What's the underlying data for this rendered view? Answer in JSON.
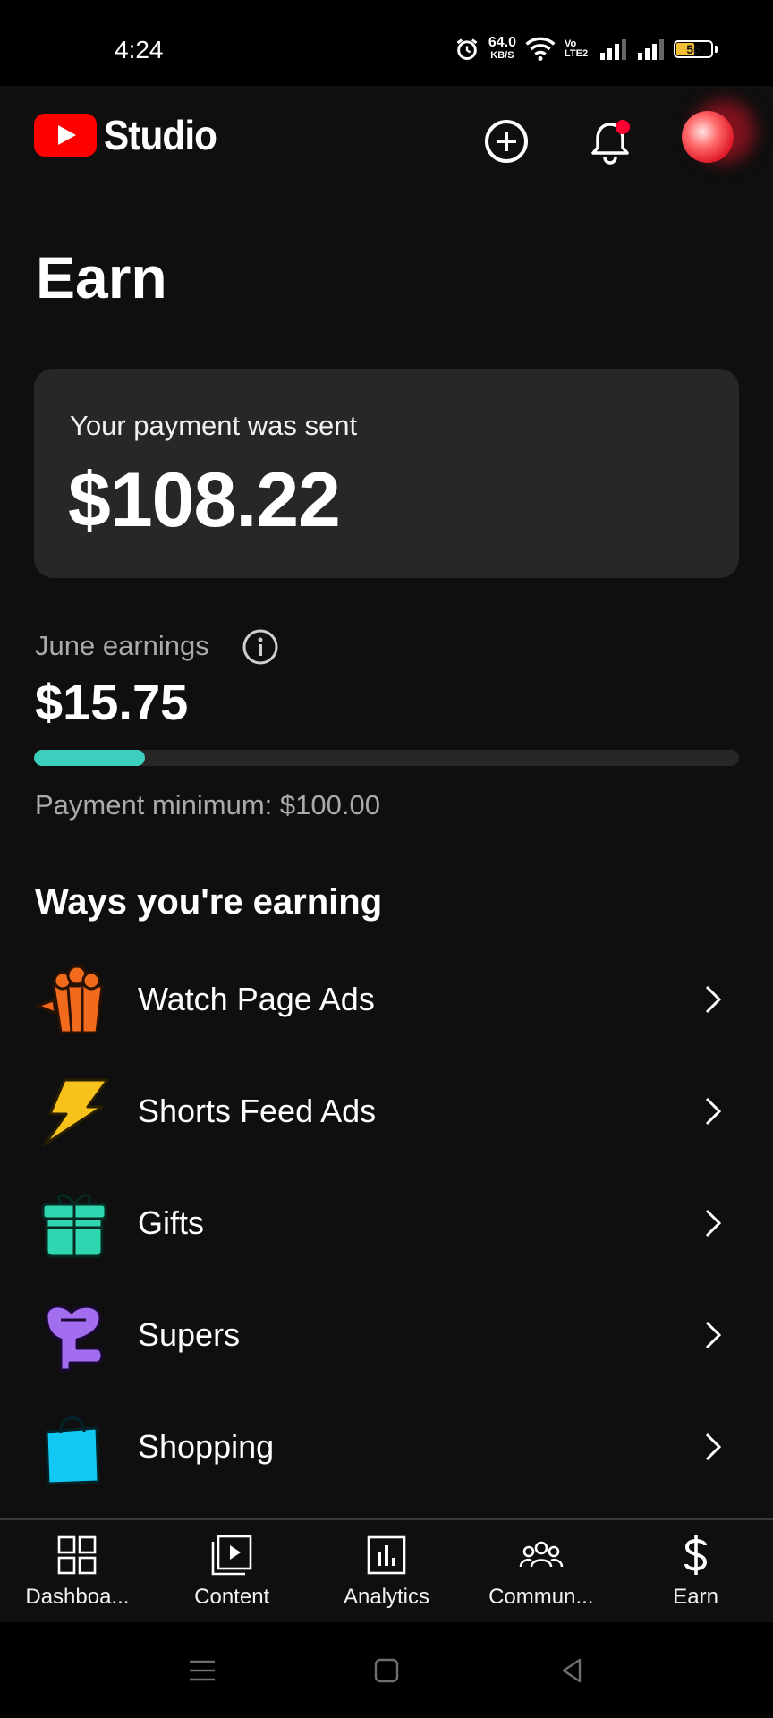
{
  "status_bar": {
    "time": "4:24",
    "net_speed": "64.0",
    "net_unit": "KB/S",
    "volte": "Vo LTE2",
    "battery": "55",
    "battery_level": 0.55
  },
  "app_bar": {
    "brand": "Studio",
    "icons": [
      "youtube-logo-icon",
      "create-icon",
      "bell-icon",
      "avatar"
    ]
  },
  "page": {
    "title": "Earn"
  },
  "payment": {
    "label": "Your payment was sent",
    "amount": "$108.22"
  },
  "earnings": {
    "label": "June earnings",
    "amount": "$15.75",
    "progress_fraction": 0.1575,
    "minimum_label": "Payment minimum: $100.00"
  },
  "ways": {
    "title": "Ways you're earning",
    "items": [
      {
        "label": "Watch Page Ads",
        "icon": "popcorn-icon"
      },
      {
        "label": "Shorts Feed Ads",
        "icon": "lightning-icon"
      },
      {
        "label": "Gifts",
        "icon": "gift-icon"
      },
      {
        "label": "Supers",
        "icon": "supers-icon"
      },
      {
        "label": "Shopping",
        "icon": "shopping-bag-icon"
      }
    ]
  },
  "bottom_nav": {
    "items": [
      {
        "label": "Dashboa...",
        "icon": "dashboard-icon"
      },
      {
        "label": "Content",
        "icon": "content-icon"
      },
      {
        "label": "Analytics",
        "icon": "analytics-icon"
      },
      {
        "label": "Commun...",
        "icon": "community-icon"
      },
      {
        "label": "Earn",
        "icon": "dollar-icon"
      }
    ],
    "active": "Earn"
  },
  "colors": {
    "background": "#0f0f0f",
    "card": "#272727",
    "progress": "#3ccfbd",
    "brand_red": "#ff0000",
    "muted_text": "#aaaaaa"
  }
}
